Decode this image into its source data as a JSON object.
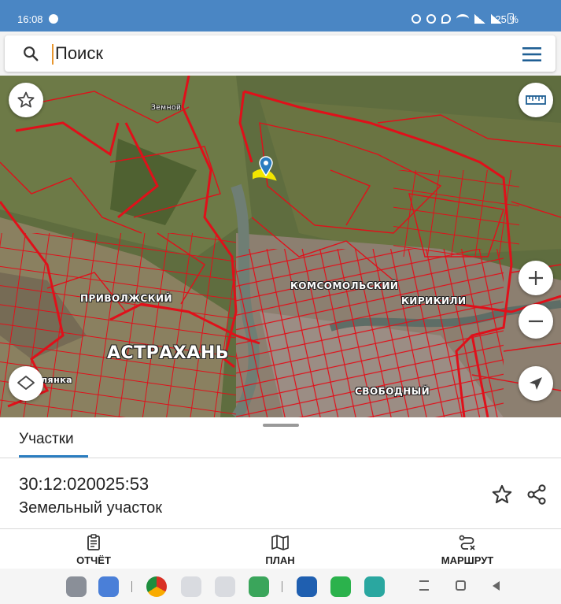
{
  "status_bar": {
    "time": "16:08",
    "battery": "25 %"
  },
  "search": {
    "placeholder": "Поиск"
  },
  "map": {
    "labels": {
      "zemnoy": "Земной",
      "privolzhsky": "ПРИВОЛЖСКИЙ",
      "komsomolsky": "КОМСОМОЛЬСКИЙ",
      "kirikili": "КИРИКИЛИ",
      "astrakhan": "АСТРАХАНЬ",
      "lyanka": "лянка",
      "svobodny": "СВОБОДНЫЙ"
    },
    "boundary_color": "#e0101a",
    "highlight_color": "#f2e600"
  },
  "sheet": {
    "tab_label": "Участки",
    "parcel_id": "30:12:020025:53",
    "parcel_type": "Земельный участок"
  },
  "actions": {
    "report": "ОТЧЁТ",
    "plan": "ПЛАН",
    "route": "МАРШРУТ"
  },
  "colors": {
    "status_bar": "#4a86c4",
    "accent": "#2a7dc0",
    "icon": "#1f5f94"
  }
}
